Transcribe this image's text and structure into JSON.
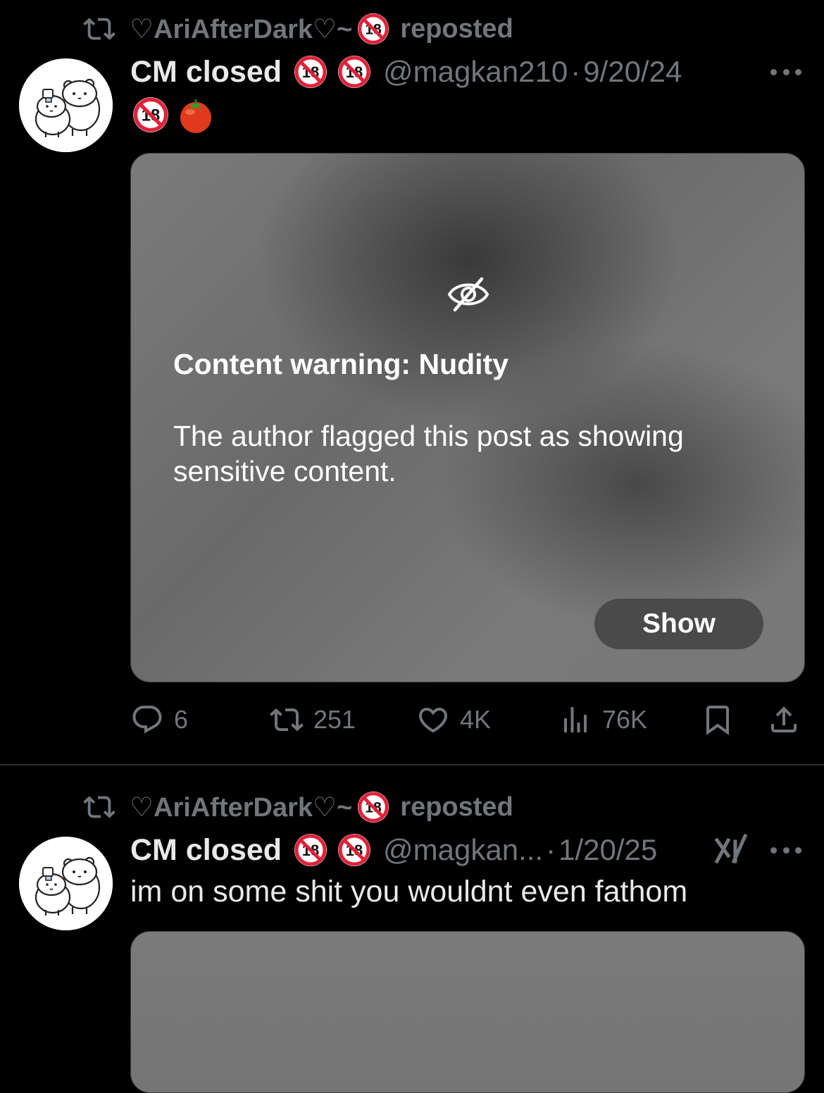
{
  "post1": {
    "repost_user": "♡AriAfterDark♡~",
    "repost_label": "reposted",
    "author_name": "CM closed",
    "handle": "@magkan210",
    "separator": "·",
    "date": "9/20/24",
    "content_warning": {
      "title": "Content warning: Nudity",
      "body": "The author flagged this post as showing sensitive content.",
      "show_label": "Show"
    },
    "stats": {
      "replies": "6",
      "reposts": "251",
      "likes": "4K",
      "views": "76K"
    }
  },
  "post2": {
    "repost_user": "♡AriAfterDark♡~",
    "repost_label": "reposted",
    "author_name": "CM closed",
    "handle": "@magkan...",
    "separator": "·",
    "date": "1/20/25",
    "text": "im on some shit you wouldnt even fathom"
  },
  "icons": {
    "repost": "repost-icon",
    "badge": "no-under-18-icon",
    "tomato": "tomato-emoji",
    "more": "more-icon",
    "hidden": "eye-slash-icon",
    "reply": "reply-icon",
    "like": "heart-icon",
    "views": "views-icon",
    "bookmark": "bookmark-icon",
    "share": "share-icon",
    "grok": "grok-icon"
  },
  "colors": {
    "background": "#000000",
    "secondary_text": "#71767b",
    "primary_text": "#e7e9ea",
    "badge_red": "#e0213a"
  }
}
